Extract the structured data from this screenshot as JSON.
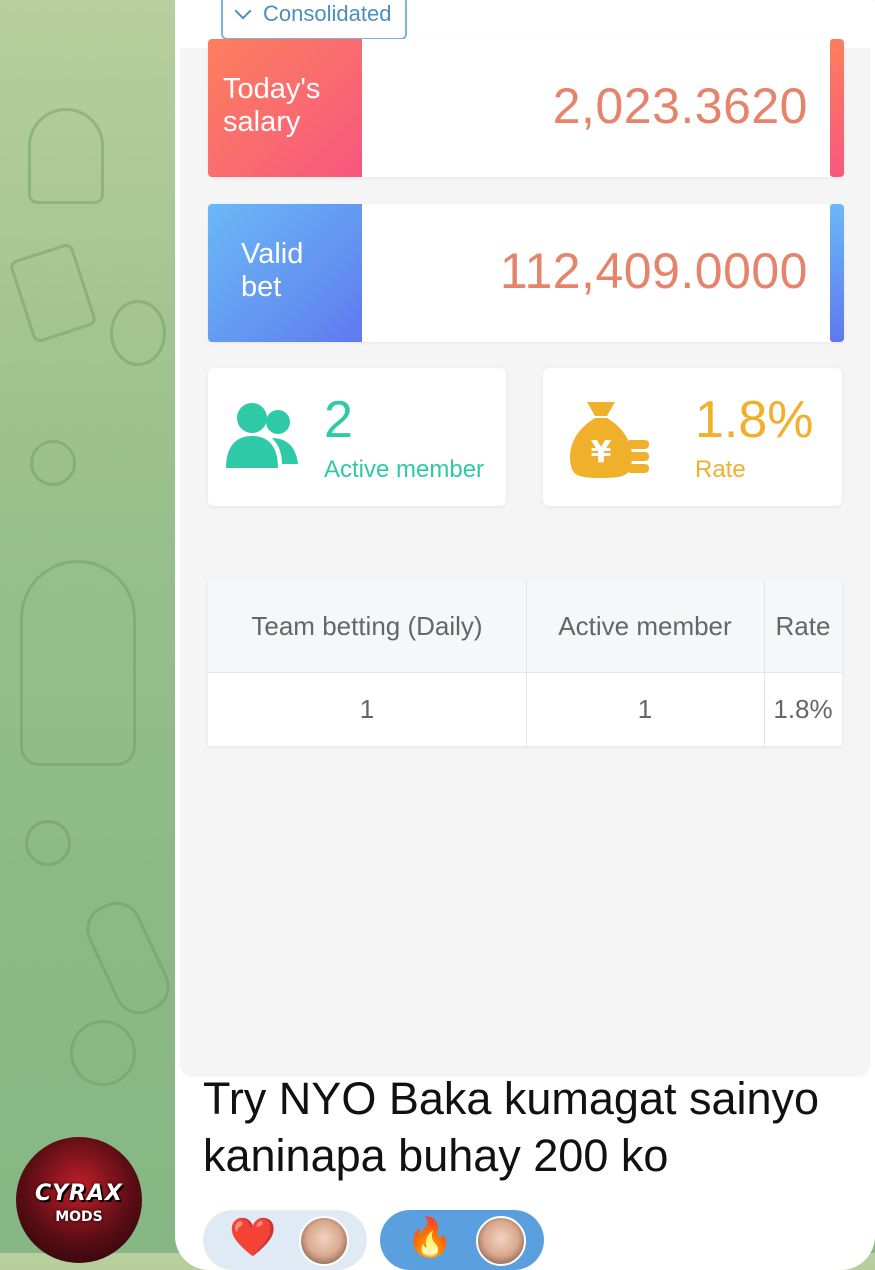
{
  "app": {
    "consolidated_label": "Consolidated"
  },
  "stats": {
    "salary": {
      "label_line1": "Today's",
      "label_line2": "salary",
      "value": "2,023.3620"
    },
    "valid_bet": {
      "label_line1": "Valid",
      "label_line2": "bet",
      "value": "112,409.0000"
    }
  },
  "summary": {
    "active_member": {
      "value": "2",
      "label": "Active member"
    },
    "rate": {
      "value": "1.8%",
      "label": "Rate"
    }
  },
  "table": {
    "headers": [
      "Team betting (Daily)",
      "Active member",
      "Rate"
    ],
    "rows": [
      [
        "1",
        "1",
        "1.8%"
      ]
    ]
  },
  "message": {
    "text": "Try NYO Baka kumagat sainyo kaninapa buhay 200 ko"
  },
  "avatar": {
    "brand": "CYRAX",
    "sub": "MODS"
  },
  "reactions": [
    {
      "emoji": "❤️"
    },
    {
      "emoji": "🔥"
    }
  ],
  "colors": {
    "salary_gradient": [
      "#fc7f5c",
      "#f8577f"
    ],
    "bet_gradient": [
      "#6ab8f6",
      "#5f79ef"
    ],
    "value_text": "#e5846a",
    "teal": "#2ec9a7",
    "gold": "#f0b02b",
    "chat_wallpaper": "#9cc18d"
  },
  "icons": {
    "members": "members-icon",
    "money_bag": "money-bag-icon",
    "dropdown": "chevron-down-icon"
  }
}
